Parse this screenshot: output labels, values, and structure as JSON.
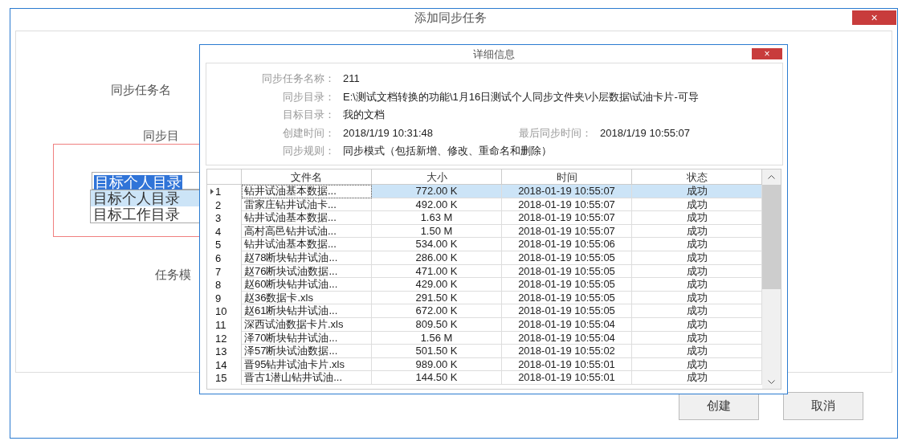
{
  "window": {
    "title": "添加同步任务",
    "close": "×"
  },
  "form": {
    "labels": [
      "同步任务名",
      "同步目",
      "任务模"
    ],
    "combo": {
      "value": "目标个人目录",
      "options": [
        {
          "label": "目标个人目录",
          "selected": true
        },
        {
          "label": "目标工作目录",
          "selected": false
        }
      ]
    }
  },
  "buttons": [
    "创建",
    "取消"
  ],
  "detail": {
    "title": "详细信息",
    "close": "×",
    "fields": [
      {
        "label": "同步任务名称：",
        "value": "211"
      },
      {
        "label": "同步目录：",
        "value": "E:\\测试文档转换的功能\\1月16日测试个人同步文件夹\\小层数据\\试油卡片-可导"
      },
      {
        "label": "目标目录：",
        "value": "我的文档"
      },
      {
        "label": "创建时间：",
        "value": "2018/1/19 10:31:48",
        "label2": "最后同步时间：",
        "value2": "2018/1/19 10:55:07"
      },
      {
        "label": "同步规则：",
        "value": "同步模式（包括新增、修改、重命名和删除）"
      }
    ],
    "table": {
      "columns": [
        "文件名",
        "大小",
        "时间",
        "状态"
      ],
      "rows": [
        {
          "index": "1",
          "cells": [
            "钻井试油基本数据...",
            "772.00 K",
            "2018-01-19 10:55:07",
            "成功"
          ],
          "selected": true
        },
        {
          "index": "2",
          "cells": [
            "雷家庄钻井试油卡...",
            "492.00 K",
            "2018-01-19 10:55:07",
            "成功"
          ],
          "selected": false
        },
        {
          "index": "3",
          "cells": [
            "钻井试油基本数据...",
            "1.63 M",
            "2018-01-19 10:55:07",
            "成功"
          ],
          "selected": false
        },
        {
          "index": "4",
          "cells": [
            "高村高邑钻井试油...",
            "1.50 M",
            "2018-01-19 10:55:07",
            "成功"
          ],
          "selected": false
        },
        {
          "index": "5",
          "cells": [
            "钻井试油基本数据...",
            "534.00 K",
            "2018-01-19 10:55:06",
            "成功"
          ],
          "selected": false
        },
        {
          "index": "6",
          "cells": [
            "赵78断块钻井试油...",
            "286.00 K",
            "2018-01-19 10:55:05",
            "成功"
          ],
          "selected": false
        },
        {
          "index": "7",
          "cells": [
            "赵76断块试油数据...",
            "471.00 K",
            "2018-01-19 10:55:05",
            "成功"
          ],
          "selected": false
        },
        {
          "index": "8",
          "cells": [
            "赵60断块钻井试油...",
            "429.00 K",
            "2018-01-19 10:55:05",
            "成功"
          ],
          "selected": false
        },
        {
          "index": "9",
          "cells": [
            "赵36数据卡.xls",
            "291.50 K",
            "2018-01-19 10:55:05",
            "成功"
          ],
          "selected": false
        },
        {
          "index": "10",
          "cells": [
            "赵61断块钻井试油...",
            "672.00 K",
            "2018-01-19 10:55:05",
            "成功"
          ],
          "selected": false
        },
        {
          "index": "11",
          "cells": [
            "深西试油数据卡片.xls",
            "809.50 K",
            "2018-01-19 10:55:04",
            "成功"
          ],
          "selected": false
        },
        {
          "index": "12",
          "cells": [
            "泽70断块钻井试油...",
            "1.56 M",
            "2018-01-19 10:55:04",
            "成功"
          ],
          "selected": false
        },
        {
          "index": "13",
          "cells": [
            "泽57断块试油数据...",
            "501.50 K",
            "2018-01-19 10:55:02",
            "成功"
          ],
          "selected": false
        },
        {
          "index": "14",
          "cells": [
            "晋95钻井试油卡片.xls",
            "989.00 K",
            "2018-01-19 10:55:01",
            "成功"
          ],
          "selected": false
        },
        {
          "index": "15",
          "cells": [
            "晋古1潜山钻井试油...",
            "144.50 K",
            "2018-01-19 10:55:01",
            "成功"
          ],
          "selected": false
        }
      ]
    }
  }
}
